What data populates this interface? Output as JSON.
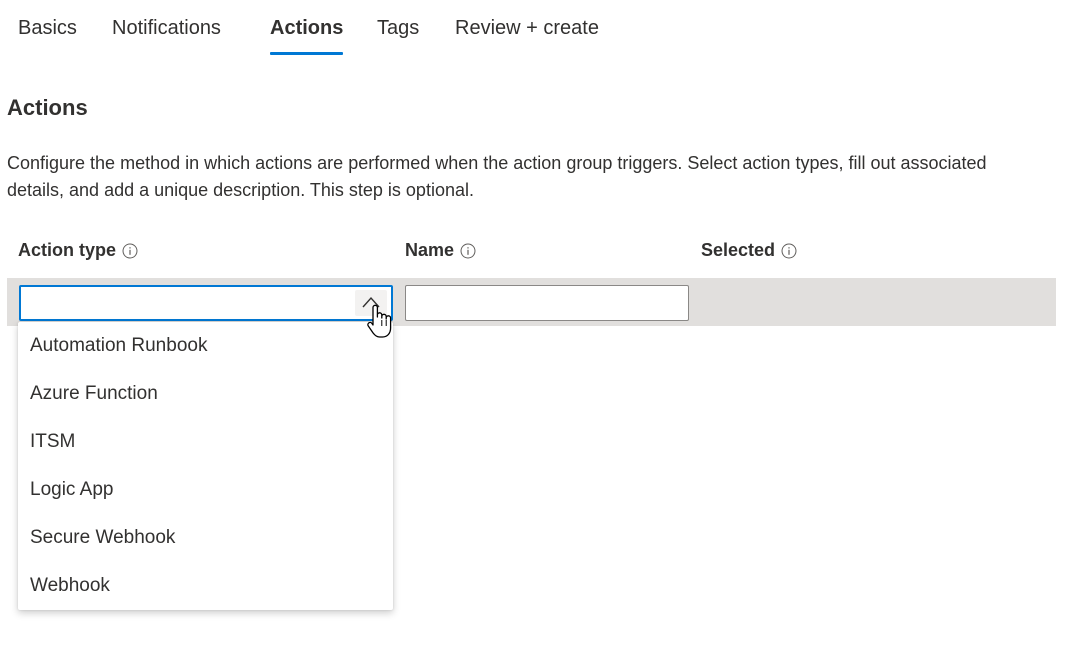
{
  "tabs": [
    {
      "label": "Basics"
    },
    {
      "label": "Notifications"
    },
    {
      "label": "Actions",
      "active": true
    },
    {
      "label": "Tags"
    },
    {
      "label": "Review + create"
    }
  ],
  "section": {
    "title": "Actions",
    "description": "Configure the method in which actions are performed when the action group triggers. Select action types, fill out associated details, and add a unique description. This step is optional."
  },
  "columns": [
    {
      "label": "Action type",
      "icon": "info-icon"
    },
    {
      "label": "Name",
      "icon": "info-icon"
    },
    {
      "label": "Selected",
      "icon": "info-icon"
    }
  ],
  "action_type_field": {
    "value": "",
    "expanded": true,
    "toggle_icon": "chevron-up-icon"
  },
  "name_field": {
    "value": ""
  },
  "dropdown": {
    "options": [
      "Automation Runbook",
      "Azure Function",
      "ITSM",
      "Logic App",
      "Secure Webhook",
      "Webhook"
    ]
  },
  "colors": {
    "accent": "#0078d4",
    "text": "#323130",
    "row_background": "#e1dfdd"
  }
}
